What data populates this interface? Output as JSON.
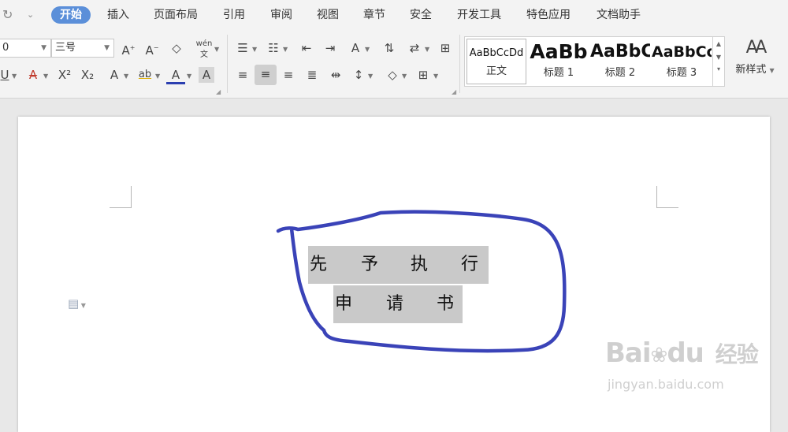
{
  "menubar": {
    "icons": [
      "redo-icon",
      "dropdown-arrow-icon"
    ],
    "tabs": [
      "开始",
      "插入",
      "页面布局",
      "引用",
      "审阅",
      "视图",
      "章节",
      "安全",
      "开发工具",
      "特色应用",
      "文档助手"
    ],
    "active_tab": "开始",
    "accent": "#5b8fd9"
  },
  "ribbon": {
    "font_name_value": "0",
    "font_size_value": "三号",
    "pinyin_glyph": "wén",
    "styles": [
      {
        "preview": "AaBbCcDd",
        "name": "正文"
      },
      {
        "preview": "AaBb",
        "name": "标题 1"
      },
      {
        "preview": "AaBbC",
        "name": "标题 2"
      },
      {
        "preview": "AaBbCc",
        "name": "标题 3"
      }
    ],
    "new_style_label": "新样式"
  },
  "document": {
    "line1": [
      "先",
      "予",
      "执",
      "行"
    ],
    "line2": [
      "申",
      "请",
      "书"
    ],
    "highlight_color": "#c9c9c9",
    "annotation_color": "#3a43b8"
  },
  "watermark": {
    "brand": "Bai",
    "brand_tail": "du",
    "brand_cn": "经验",
    "url": "jingyan.baidu.com"
  }
}
